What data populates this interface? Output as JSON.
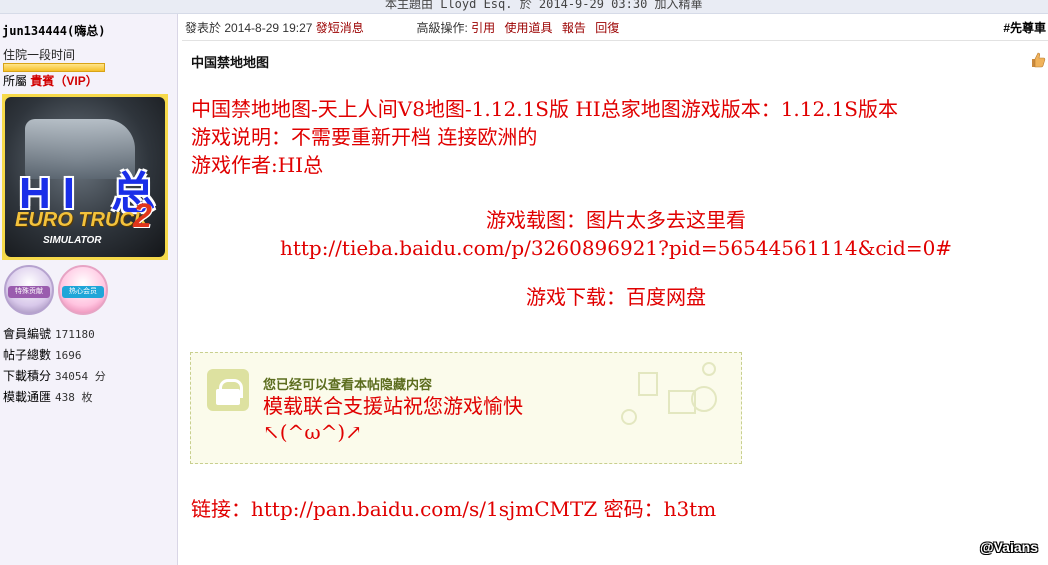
{
  "topbar": {
    "text": "本主題由 Lloyd Esq. 於 2014-9-29 03:30 加入精華"
  },
  "user": {
    "name": "jun134444(嗨总)",
    "rank": "住院一段时间",
    "group_label": "所屬",
    "group": "貴賓（VIP）",
    "avatar": {
      "hi_text": "HI 总",
      "game_logo": "EURO TRUCK",
      "game_num": "2",
      "game_sub": "SIMULATOR"
    },
    "medals": [
      "特殊贡献",
      "热心会员"
    ],
    "stats": [
      {
        "label": "會員編號",
        "value": "171180"
      },
      {
        "label": "帖子總數",
        "value": "1696"
      },
      {
        "label": "下載積分",
        "value": "34054 分"
      },
      {
        "label": "模載通匯",
        "value": "438 枚"
      }
    ]
  },
  "post": {
    "meta_prefix": "發表於",
    "date": "2014-8-29 19:27",
    "pm": "發短消息",
    "admin_label": "高級操作:",
    "actions": [
      "引用",
      "使用道具",
      "報告",
      "回復"
    ],
    "floor": "#先尊車",
    "title": "中国禁地地图",
    "lines": [
      "中国禁地地图-天上人间V8地图-1.12.1S版 HI总家地图游戏版本：1.12.1S版本",
      "游戏说明：不需要重新开档 连接欧洲的",
      "游戏作者:HI总"
    ],
    "screens_label": "游戏载图：图片太多去这里看",
    "screens_url": "http://tieba.baidu.com/p/3260896921?pid=56544561114&cid=0#",
    "download_label": "游戏下载：百度网盘",
    "hidden": {
      "note": "您已经可以查看本帖隐藏内容",
      "line1": "模载联合支援站祝您游戏愉快",
      "line2": "↖(^ω^)↗"
    },
    "link_line": "链接：http://pan.baidu.com/s/1sjmCMTZ 密码：h3tm"
  },
  "watermark": "@Vaians",
  "colors": {
    "accent_red": "#e00000",
    "sidebar_bg": "#f4f2fa",
    "hidden_bg": "#fbfbeb"
  }
}
